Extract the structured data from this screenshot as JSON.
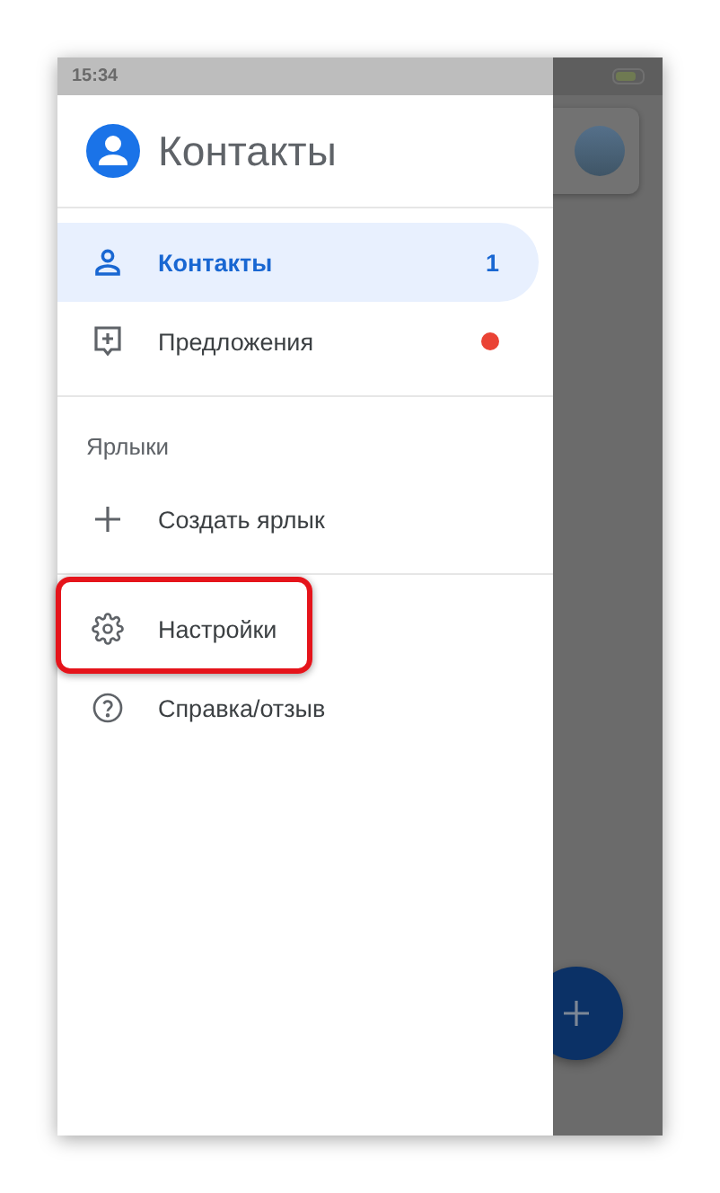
{
  "status_bar": {
    "time": "15:34"
  },
  "drawer": {
    "title": "Контакты",
    "items": [
      {
        "label": "Контакты",
        "selected": true,
        "count": "1"
      },
      {
        "label": "Предложения",
        "selected": false,
        "color": "#ea4335"
      }
    ],
    "labels_section": {
      "heading": "Ярлыки",
      "items": [
        {
          "label": "Создать ярлык"
        }
      ]
    },
    "footer_items": [
      {
        "label": "Настройки",
        "highlighted": true
      },
      {
        "label": "Справка/отзыв",
        "highlighted": false
      }
    ]
  }
}
